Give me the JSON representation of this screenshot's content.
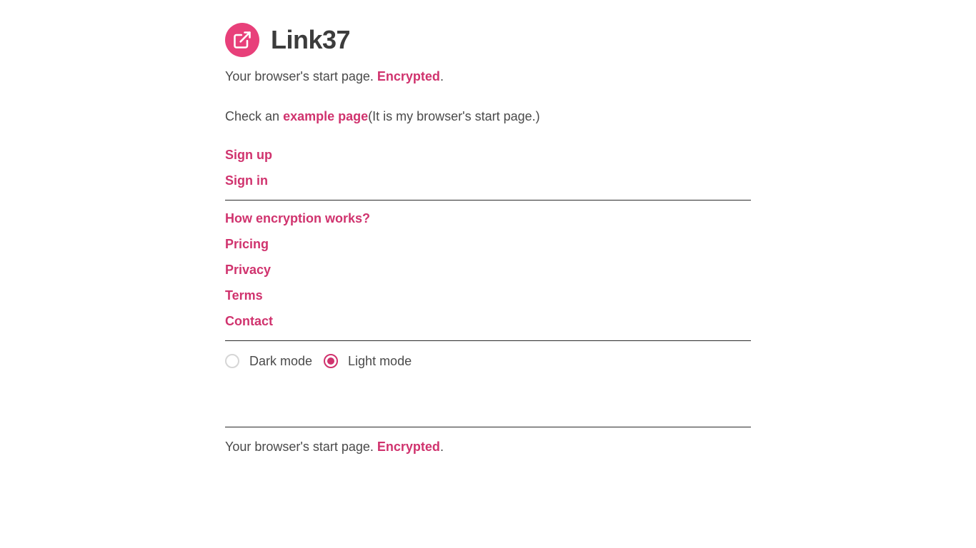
{
  "brand": {
    "name": "Link37",
    "icon": "external-link-icon",
    "color": "#e8407a"
  },
  "tagline": {
    "prefix": "Your browser's start page.",
    "accent": "Encrypted",
    "suffix": "."
  },
  "example": {
    "prefix": "Check an",
    "link": "example page",
    "suffix": "(It is my browser's start page.)"
  },
  "auth_links": [
    {
      "label": "Sign up"
    },
    {
      "label": "Sign in"
    }
  ],
  "info_links": [
    {
      "label": "How encryption works?"
    },
    {
      "label": "Pricing"
    },
    {
      "label": "Privacy"
    },
    {
      "label": "Terms"
    },
    {
      "label": "Contact"
    }
  ],
  "theme": {
    "options": [
      {
        "label": "Dark mode",
        "checked": false
      },
      {
        "label": "Light mode",
        "checked": true
      }
    ]
  },
  "footer": {
    "prefix": "Your browser's start page.",
    "accent": "Encrypted",
    "suffix": "."
  },
  "colors": {
    "accent": "#d0336e",
    "text": "#4a4a4a",
    "rule": "#2a2a2a"
  }
}
